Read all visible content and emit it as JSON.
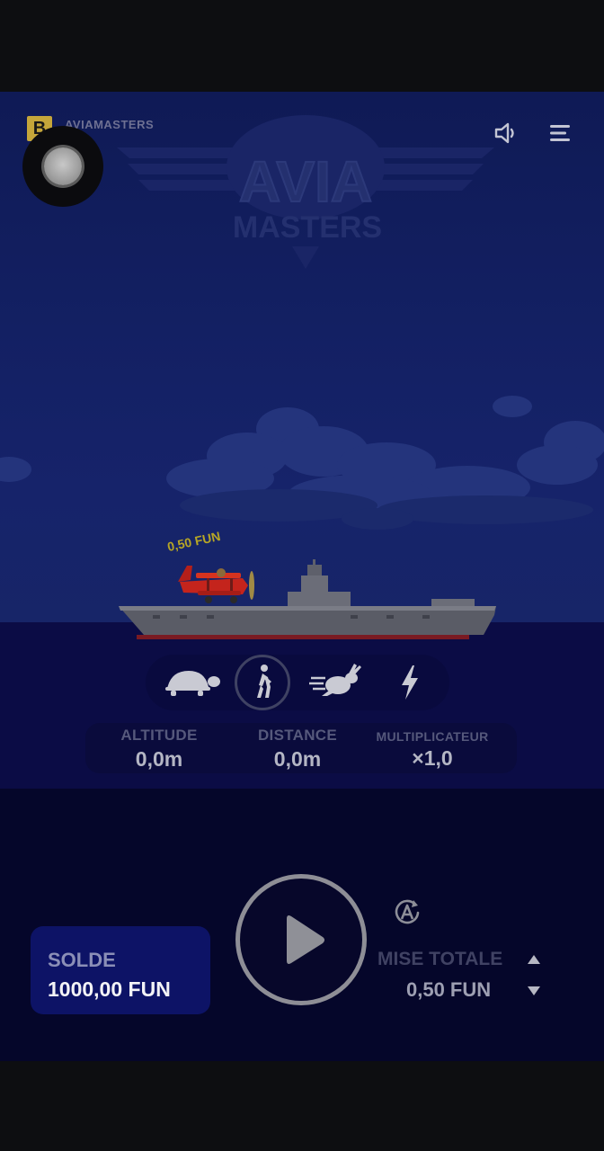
{
  "header": {
    "brand_badge": "B",
    "brand_name": "AVIAMASTERS",
    "sound_icon": "speaker-icon",
    "menu_icon": "hamburger-menu-icon"
  },
  "logo": {
    "line1": "AVIA",
    "line2": "MASTERS"
  },
  "scene": {
    "bet_floating_label": "0,50 FUN"
  },
  "speed_selector": {
    "options": [
      "turtle",
      "walk",
      "rabbit",
      "lightning"
    ],
    "selected": "walk"
  },
  "stats": {
    "altitude_label": "ALTITUDE",
    "altitude_value": "0,0m",
    "distance_label": "DISTANCE",
    "distance_value": "0,0m",
    "multiplier_label": "MULTIPLICATEUR",
    "multiplier_value": "×1,0"
  },
  "balance": {
    "label": "SOLDE",
    "value": "1000,00 FUN"
  },
  "bet": {
    "label": "MISE TOTALE",
    "value": "0,50 FUN"
  },
  "colors": {
    "balance_card": "#0d1366",
    "sky": "#16236a",
    "sea": "#0b0c45",
    "plane": "#c4241c",
    "bet_label": "#b7a625"
  }
}
